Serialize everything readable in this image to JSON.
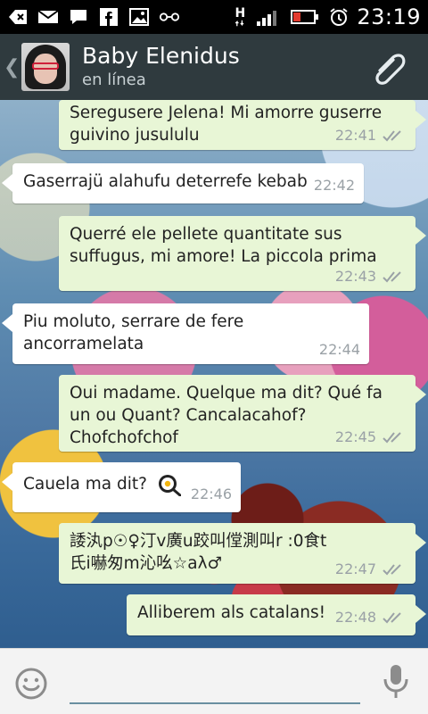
{
  "status_bar": {
    "time": "23:19",
    "network_type": "H"
  },
  "header": {
    "contact_name": "Baby Elenidus",
    "status": "en línea"
  },
  "messages": [
    {
      "dir": "out",
      "text": "Seregusere Jelena! Mi amorre guserre guivino jusululu",
      "time": "22:41"
    },
    {
      "dir": "in",
      "text": "Gaserrajü alahufu deterrefe kebab",
      "time": "22:42"
    },
    {
      "dir": "out",
      "text": "Querré ele pellete quantitate sus suffugus, mi amore! La piccola prima",
      "time": "22:43"
    },
    {
      "dir": "in",
      "text": "Piu moluto, serrare de fere ancorramelata",
      "time": "22:44"
    },
    {
      "dir": "out",
      "text": "Oui madame. Quelque ma dit? Qué fa un ou Quant? Cancalacahof? Chofchofchof",
      "time": "22:45"
    },
    {
      "dir": "in",
      "text": "Cauela ma dit?",
      "time": "22:46",
      "emoji": "frying-pan-egg"
    },
    {
      "dir": "out",
      "text": "諉汍p☉♀汀v廣u跤叫㑽測叫r :0食t氏i嚇匆m沁吆☆aλ♂",
      "time": "22:47"
    },
    {
      "dir": "out",
      "text": "Alliberem als catalans!",
      "time": "22:48"
    }
  ],
  "composer": {
    "placeholder": ""
  },
  "colors": {
    "header_bg": "#2f3a3e",
    "out_bubble": "#e8f6d6",
    "in_bubble": "#ffffff",
    "input_underline": "#6a8fa1"
  }
}
